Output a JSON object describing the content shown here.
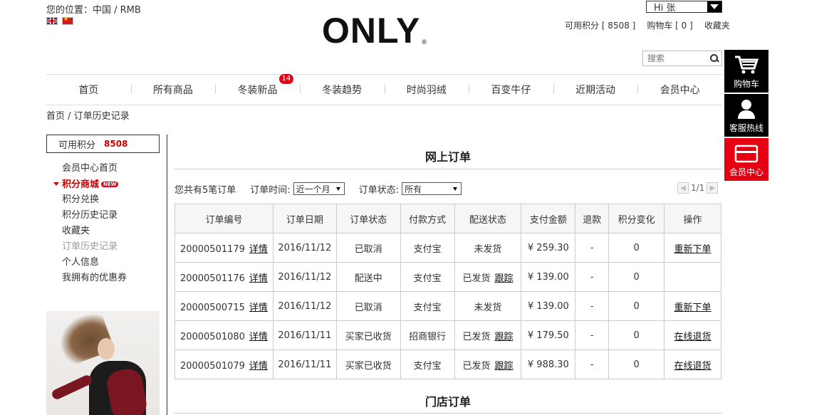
{
  "header": {
    "location_label": "您的位置：中国 / RMB",
    "logo_text": "ONLY",
    "logo_mark": "®",
    "user_greeting": "Hi 张",
    "points_link": "可用积分 [ 8508 ]",
    "cart_link": "购物车 [ 0 ]",
    "favorites_link": "收藏夹",
    "search_placeholder": "搜索"
  },
  "nav": {
    "items": [
      "首页",
      "所有商品",
      "冬装新品",
      "冬装趋势",
      "时尚羽绒",
      "百变牛仔",
      "近期活动",
      "会员中心"
    ],
    "new_count": "14"
  },
  "breadcrumb": "首页 / 订单历史记录",
  "float_bar": {
    "cart": "购物车",
    "service": "客服热线",
    "member": "会员中心"
  },
  "sidebar": {
    "points_label": "可用积分",
    "points_value": "8508",
    "menu": [
      "会员中心首页",
      "积分商城",
      "积分兑换",
      "积分历史记录",
      "收藏夹",
      "订单历史记录",
      "个人信息",
      "我拥有的优惠券"
    ],
    "new_badge": "NEW"
  },
  "online_orders": {
    "title": "网上订单",
    "summary": "您共有5笔订单",
    "time_label": "订单时间:",
    "time_value": "近一个月",
    "status_label": "订单状态:",
    "status_value": "所有",
    "page_info": "1/1",
    "columns": [
      "订单编号",
      "订单日期",
      "订单状态",
      "付款方式",
      "配送状态",
      "支付金额",
      "退款",
      "积分变化",
      "操作"
    ],
    "detail_label": "详情",
    "track_label": "跟踪",
    "rows": [
      {
        "id": "20000501179",
        "date": "2016/11/12",
        "status": "已取消",
        "payment": "支付宝",
        "delivery": "未发货",
        "amount": "¥ 259.30",
        "refund": "-",
        "points": "0",
        "action": "重新下单"
      },
      {
        "id": "20000501176",
        "date": "2016/11/12",
        "status": "配送中",
        "payment": "支付宝",
        "delivery": "已发货",
        "amount": "¥ 139.00",
        "refund": "-",
        "points": "0",
        "action": ""
      },
      {
        "id": "20000500715",
        "date": "2016/11/12",
        "status": "已取消",
        "payment": "支付宝",
        "delivery": "未发货",
        "amount": "¥ 139.00",
        "refund": "-",
        "points": "0",
        "action": "重新下单"
      },
      {
        "id": "20000501080",
        "date": "2016/11/11",
        "status": "买家已收货",
        "payment": "招商银行",
        "delivery": "已发货",
        "amount": "¥ 179.50",
        "refund": "-",
        "points": "0",
        "action": "在线退货"
      },
      {
        "id": "20000501079",
        "date": "2016/11/11",
        "status": "买家已收货",
        "payment": "支付宝",
        "delivery": "已发货",
        "amount": "¥ 988.30",
        "refund": "-",
        "points": "0",
        "action": "在线退货"
      }
    ]
  },
  "store_orders": {
    "title": "门店订单"
  }
}
